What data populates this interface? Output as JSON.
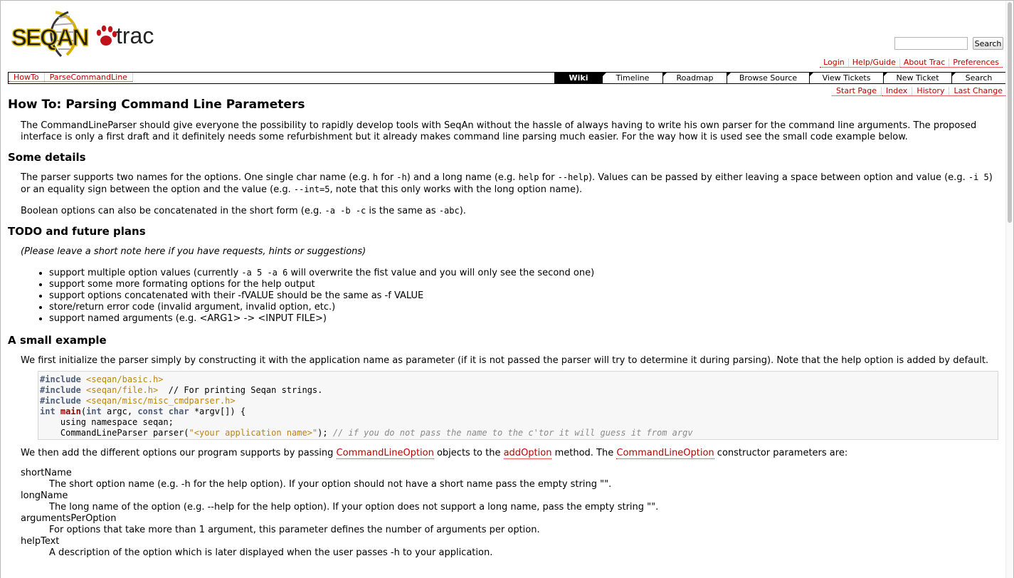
{
  "header": {
    "logo_text_seqan": "SEQAN",
    "logo_text_trac": "trac",
    "search_value": "",
    "search_button": "Search"
  },
  "metanav": [
    "Login",
    "Help/Guide",
    "About Trac",
    "Preferences"
  ],
  "breadcrumbs": [
    "HowTo",
    "ParseCommandLine"
  ],
  "mainnav": [
    {
      "label": "Wiki",
      "active": true
    },
    {
      "label": "Timeline"
    },
    {
      "label": "Roadmap"
    },
    {
      "label": "Browse Source"
    },
    {
      "label": "View Tickets"
    },
    {
      "label": "New Ticket"
    },
    {
      "label": "Search"
    }
  ],
  "ctxtnav": [
    "Start Page",
    "Index",
    "History",
    "Last Change"
  ],
  "page": {
    "title": "How To: Parsing Command Line Parameters",
    "intro": "The CommandLineParser should give everyone the possibility to rapidly develop tools with SeqAn without the hassle of always having to write his own parser for the command line arguments. The proposed interface is only a first draft and it definitely needs some refurbishment but it already makes command line parsing much easier. For the way how it is used see the small code example below.",
    "h_details": "Some details",
    "details_1": {
      "a": "The parser supports two names for the options. One single char name (e.g. ",
      "c1": "h",
      "b": " for ",
      "c2": "-h",
      "c": ") and a long name (e.g. ",
      "c3": "help",
      "d": " for ",
      "c4": "--help",
      "e": "). Values can be passed by either leaving a space between option and value (e.g. ",
      "c5": "-i 5",
      "f": ") or an equality sign between the option and the value (e.g. ",
      "c6": "--int=5",
      "g": ", note that this only works with the long option name)."
    },
    "details_2": {
      "a": "Boolean options can also be concatenated in the short form (e.g. ",
      "c1": "-a -b -c",
      "b": " is the same as ",
      "c2": "-abc",
      "c": ")."
    },
    "h_todo": "TODO and future plans",
    "todo_note": "(Please leave a short note here if you have requests, hints or suggestions)",
    "todo_items": {
      "i1a": "support multiple option values (currently ",
      "i1c": "-a 5 -a 6",
      "i1b": " will overwrite the fist value and you will only see the second one)",
      "i2": "support some more formating options for the help output",
      "i3": "support options concatenated with their -fVALUE should be the same as -f VALUE",
      "i4": "store/return error code (invalid argument, invalid option, etc.)",
      "i5": "support named arguments (e.g. <ARG1> -> <INPUT FILE>)"
    },
    "h_example": "A small example",
    "example_intro": "We first initialize the parser simply by constructing it with the application name as parameter (if it is not passed the parser will try to determine it during parsing). Note that the help option is added by default.",
    "code": {
      "pp": "#include",
      "inc1": "<seqan/basic.h>",
      "inc2": "<seqan/file.h>",
      "cm1": "// For printing Seqan strings.",
      "inc3": "<seqan/misc/misc_cmdparser.h>",
      "kw_int": "int",
      "fn_main": "main",
      "sig_a": "(",
      "sig_b": " argc, ",
      "kw_const": "const",
      "kw_char": "char",
      "sig_c": " *argv[]) {",
      "l5": "    using namespace seqan;",
      "l6a": "    CommandLineParser parser(",
      "l6s": "\"<your application name>\"",
      "l6b": "); ",
      "cm2": "// if you do not pass the name to the c'tor it will guess it from argv"
    },
    "after_code": {
      "a": "We then add the different options our program supports by passing ",
      "l1": "CommandLineOption",
      "b": " objects to the ",
      "l2": "addOption",
      "c": " method. The ",
      "l3": "CommandLineOption",
      "d": " constructor parameters are:"
    },
    "params": [
      {
        "term": "shortName",
        "desc": "The short option name (e.g. -h for the help option). If your option should not have a short name pass the empty string \"\"."
      },
      {
        "term": "longName",
        "desc": "The long name of the option (e.g. --help for the help option). If your option does not support a long name, pass the empty string \"\"."
      },
      {
        "term": "argumentsPerOption",
        "desc": "For options that take more than 1 argument, this parameter defines the number of arguments per option."
      },
      {
        "term": "helpText",
        "desc": "A description of the option which is later displayed when the user passes -h to your application."
      }
    ]
  }
}
